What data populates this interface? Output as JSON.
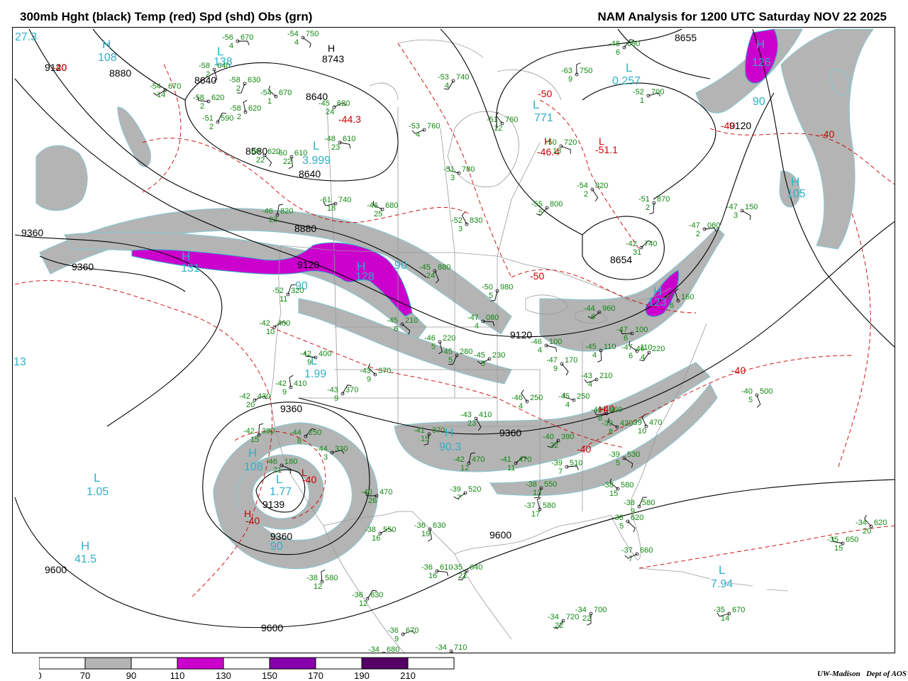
{
  "header": {
    "left": "300mb Hght (black) Temp (red) Spd (shd) Obs (grn)",
    "right": "NAM Analysis for 1200 UTC Saturday  NOV 22 2025"
  },
  "colors": {
    "height": "#000000",
    "temp": "#cc0000",
    "obs": "#118811",
    "label": "#30b0c8",
    "spd_70_90": "#b4b4b4",
    "spd_110_130": "#cc00cc",
    "spd_150_170": "#8800aa",
    "spd_190_210": "#550066"
  },
  "height_labels": [
    "9120",
    "8880",
    "8743",
    "8640",
    "8640",
    "8580",
    "8640",
    "8880",
    "9360",
    "9360",
    "9120",
    "9120",
    "8654",
    "8655",
    "9120",
    "9360",
    "9360",
    "9139",
    "9360",
    "9600",
    "9600",
    "9600"
  ],
  "temp_labels": [
    "-44.3",
    "-46.4",
    "-51.1",
    "-50",
    "-40",
    "-40",
    "-40",
    "-50",
    "-40",
    "-40",
    "-40",
    "-40",
    "-40"
  ],
  "speed_centers": [
    {
      "type": "H",
      "value": "108"
    },
    {
      "type": "L",
      "value": "138"
    },
    {
      "type": "H",
      "value": "131"
    },
    {
      "type": "H",
      "value": "128"
    },
    {
      "type": "L",
      "value": "3.999"
    },
    {
      "type": "L",
      "value": "1.99"
    },
    {
      "type": "H",
      "value": "108"
    },
    {
      "type": "L",
      "value": "1.05"
    },
    {
      "type": "H",
      "value": "41.5"
    },
    {
      "type": "L",
      "value": "1.77"
    },
    {
      "type": "H",
      "value": "90.3"
    },
    {
      "type": "L",
      "value": "7.94"
    },
    {
      "type": "L",
      "value": "0.257"
    },
    {
      "type": "L",
      "value": "771"
    },
    {
      "type": "H",
      "value": "126"
    },
    {
      "type": "H",
      "value": "105"
    },
    {
      "type": "H",
      "value": "123"
    }
  ],
  "contour_side_labels": [
    "27.3",
    "90",
    "90",
    "90",
    "90",
    "13"
  ],
  "obs": [
    {
      "t": "-56",
      "h": "670",
      "s": "4"
    },
    {
      "t": "-54",
      "h": "750",
      "s": "4"
    },
    {
      "t": "-58",
      "h": "640",
      "s": "2"
    },
    {
      "t": "-58",
      "h": "630",
      "s": "2"
    },
    {
      "t": "-54",
      "h": "670",
      "s": "14"
    },
    {
      "t": "-58",
      "h": "620",
      "s": "2"
    },
    {
      "t": "-54",
      "h": "670",
      "s": "1"
    },
    {
      "t": "-58",
      "h": "620",
      "s": "2"
    },
    {
      "t": "-51",
      "h": "590",
      "s": "2"
    },
    {
      "t": "-45",
      "h": "620",
      "s": "24"
    },
    {
      "t": "-48",
      "h": "610",
      "s": "23"
    },
    {
      "t": "-60",
      "h": "620",
      "s": "22"
    },
    {
      "t": "-60",
      "h": "610",
      "s": "22"
    },
    {
      "t": "-53",
      "h": "740",
      "s": "4"
    },
    {
      "t": "-53",
      "h": "760",
      "s": "4"
    },
    {
      "t": "-51",
      "h": "780",
      "s": "3"
    },
    {
      "t": "-51",
      "h": "760",
      "s": "12"
    },
    {
      "t": "-63",
      "h": "750",
      "s": "9"
    },
    {
      "t": "-48",
      "h": "690",
      "s": "6"
    },
    {
      "t": "-52",
      "h": "700",
      "s": "1"
    },
    {
      "t": "-50",
      "h": "720",
      "s": "13"
    },
    {
      "t": "-54",
      "h": "820",
      "s": "2"
    },
    {
      "t": "-51",
      "h": "870",
      "s": "2"
    },
    {
      "t": "-55",
      "h": "800",
      "s": "5"
    },
    {
      "t": "-61",
      "h": "740",
      "s": "18"
    },
    {
      "t": "-46",
      "h": "680",
      "s": "25"
    },
    {
      "t": "-52",
      "h": "830",
      "s": "3"
    },
    {
      "t": "-46",
      "h": "820",
      "s": "23"
    },
    {
      "t": "-42",
      "h": "740",
      "s": "31"
    },
    {
      "t": "-47",
      "h": "060",
      "s": "2"
    },
    {
      "t": "-47",
      "h": "150",
      "s": "3"
    },
    {
      "t": "-45",
      "h": "880",
      "s": "24"
    },
    {
      "t": "-50",
      "h": "980",
      "s": "5"
    },
    {
      "t": "-44",
      "h": "960",
      "s": "6"
    },
    {
      "t": "-47",
      "h": "100",
      "s": "6"
    },
    {
      "t": "-47",
      "h": "110",
      "s": "6"
    },
    {
      "t": "-47",
      "h": "160",
      "s": "6"
    },
    {
      "t": "-52",
      "h": "320",
      "s": "11"
    },
    {
      "t": "-42",
      "h": "400",
      "s": "10"
    },
    {
      "t": "-47",
      "h": "080",
      "s": "4"
    },
    {
      "t": "-45",
      "h": "210",
      "s": "6"
    },
    {
      "t": "-46",
      "h": "220",
      "s": "5"
    },
    {
      "t": "-45",
      "h": "280",
      "s": "5"
    },
    {
      "t": "-45",
      "h": "230",
      "s": "5"
    },
    {
      "t": "-42",
      "h": "400",
      "s": "9"
    },
    {
      "t": "-43",
      "h": "370",
      "s": "9"
    },
    {
      "t": "-42",
      "h": "410",
      "s": "9"
    },
    {
      "t": "-43",
      "h": "370",
      "s": "9"
    },
    {
      "t": "-42",
      "h": "430",
      "s": "20"
    },
    {
      "t": "-46",
      "h": "100",
      "s": "4"
    },
    {
      "t": "-47",
      "h": "170",
      "s": "9"
    },
    {
      "t": "-45",
      "h": "110",
      "s": "4"
    },
    {
      "t": "-46",
      "h": "220",
      "s": "4"
    },
    {
      "t": "-43",
      "h": "210",
      "s": "4"
    },
    {
      "t": "-45",
      "h": "250",
      "s": "4"
    },
    {
      "t": "-46",
      "h": "250",
      "s": "4"
    },
    {
      "t": "-42",
      "h": "380",
      "s": "15"
    },
    {
      "t": "-44",
      "h": "250",
      "s": "8"
    },
    {
      "t": "-44",
      "h": "330",
      "s": "3"
    },
    {
      "t": "-46",
      "h": "180",
      "s": "21"
    },
    {
      "t": "-43",
      "h": "410",
      "s": "23"
    },
    {
      "t": "-41",
      "h": "370",
      "s": "15"
    },
    {
      "t": "-40",
      "h": "390",
      "s": "22"
    },
    {
      "t": "-40",
      "h": "460",
      "s": "8"
    },
    {
      "t": "-39",
      "h": "420",
      "s": "8"
    },
    {
      "t": "-39",
      "h": "470",
      "s": "10"
    },
    {
      "t": "-42",
      "h": "470",
      "s": "12"
    },
    {
      "t": "-41",
      "h": "470",
      "s": "11"
    },
    {
      "t": "-39",
      "h": "510",
      "s": "7"
    },
    {
      "t": "-39",
      "h": "530",
      "s": "5"
    },
    {
      "t": "-40",
      "h": "500",
      "s": "5"
    },
    {
      "t": "-38",
      "h": "550",
      "s": "13"
    },
    {
      "t": "-39",
      "h": "520",
      "s": "7"
    },
    {
      "t": "-40",
      "h": "470",
      "s": "26"
    },
    {
      "t": "-38",
      "h": "580",
      "s": "15"
    },
    {
      "t": "-37",
      "h": "580",
      "s": "17"
    },
    {
      "t": "-38",
      "h": "580",
      "s": "9"
    },
    {
      "t": "-38",
      "h": "550",
      "s": "16"
    },
    {
      "t": "-36",
      "h": "610",
      "s": "16"
    },
    {
      "t": "-38",
      "h": "620",
      "s": "5"
    },
    {
      "t": "-36",
      "h": "630",
      "s": "19"
    },
    {
      "t": "-35",
      "h": "640",
      "s": "21"
    },
    {
      "t": "-37",
      "h": "660",
      "s": "7"
    },
    {
      "t": "-35",
      "h": "650",
      "s": "15"
    },
    {
      "t": "-34",
      "h": "620",
      "s": "20"
    },
    {
      "t": "-38",
      "h": "580",
      "s": "12"
    },
    {
      "t": "-36",
      "h": "630",
      "s": "12"
    },
    {
      "t": "-36",
      "h": "670",
      "s": "9"
    },
    {
      "t": "-34",
      "h": "680",
      "s": "3"
    },
    {
      "t": "-34",
      "h": "710",
      "s": "3"
    },
    {
      "t": "-34",
      "h": "700",
      "s": "22"
    },
    {
      "t": "-34",
      "h": "720",
      "s": "22"
    },
    {
      "t": "-35",
      "h": "670",
      "s": "14"
    }
  ],
  "legend": {
    "ticks": [
      "0",
      "70",
      "90",
      "110",
      "130",
      "150",
      "170",
      "190",
      "210"
    ],
    "bins": [
      {
        "from": 0,
        "to": 70,
        "color": "#ffffff"
      },
      {
        "from": 70,
        "to": 90,
        "color": "#b4b4b4"
      },
      {
        "from": 90,
        "to": 110,
        "color": "#ffffff"
      },
      {
        "from": 110,
        "to": 130,
        "color": "#cc00cc"
      },
      {
        "from": 130,
        "to": 150,
        "color": "#ffffff"
      },
      {
        "from": 150,
        "to": 170,
        "color": "#8800aa"
      },
      {
        "from": 170,
        "to": 190,
        "color": "#ffffff"
      },
      {
        "from": 190,
        "to": 210,
        "color": "#550066"
      },
      {
        "from": 210,
        "to": 230,
        "color": "#ffffff"
      }
    ]
  },
  "credit": {
    "org": "UW-Madison",
    "dept": "Dept of AOS"
  }
}
